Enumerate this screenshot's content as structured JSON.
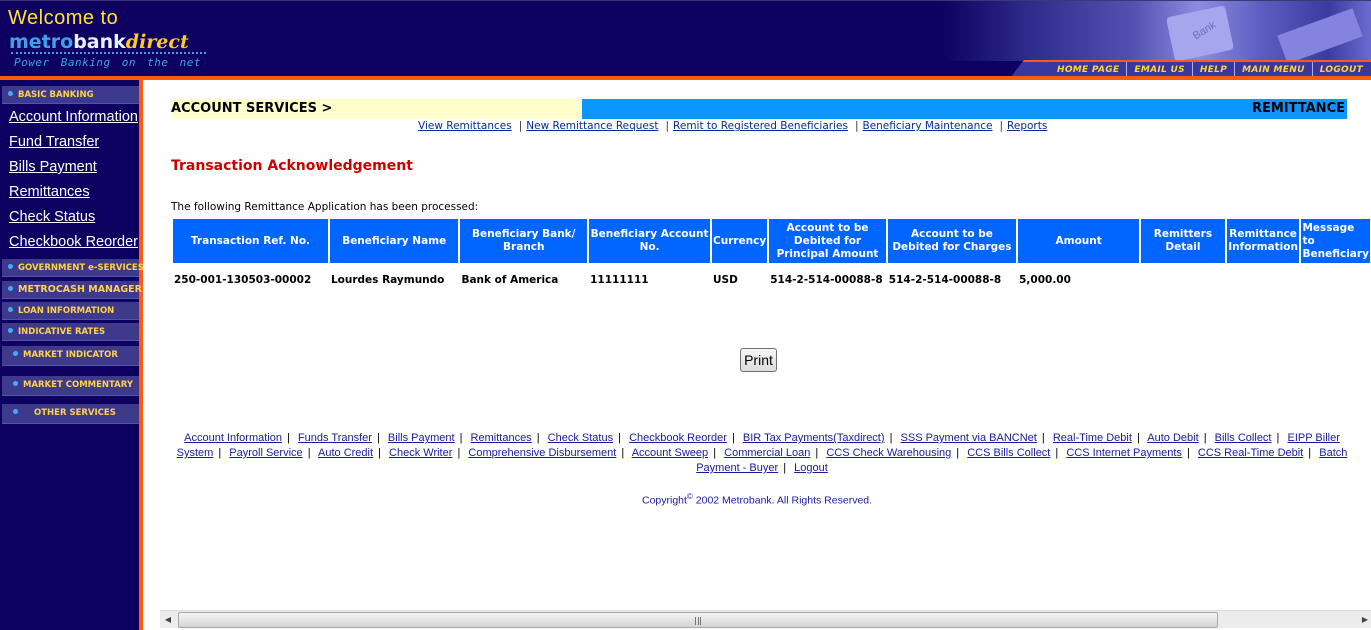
{
  "header": {
    "welcome": "Welcome to",
    "brand_metro": "metro",
    "brand_bank": "bank",
    "brand_direct": "direct",
    "tagline": "Power Banking on the net",
    "photo_key_label": "Bank",
    "nav": [
      {
        "label": "HOME PAGE"
      },
      {
        "label": "EMAIL US"
      },
      {
        "label": "HELP"
      },
      {
        "label": "MAIN MENU"
      },
      {
        "label": "LOGOUT"
      }
    ]
  },
  "sidebar": {
    "basic_banking": "BASIC BANKING",
    "links": [
      {
        "label": "Account Information"
      },
      {
        "label": "Fund Transfer"
      },
      {
        "label": "Bills Payment"
      },
      {
        "label": "Remittances"
      },
      {
        "label": "Check Status"
      },
      {
        "label": "Checkbook Reorder"
      }
    ],
    "sections": [
      {
        "label": "GOVERNMENT e-SERVICES"
      },
      {
        "label": "METROCASH MANAGER"
      },
      {
        "label": "LOAN INFORMATION"
      },
      {
        "label": "INDICATIVE RATES"
      },
      {
        "label": "MARKET INDICATOR"
      },
      {
        "label": "MARKET COMMENTARY"
      },
      {
        "label": "OTHER SERVICES"
      }
    ]
  },
  "breadcrumb": {
    "left": "ACCOUNT SERVICES >",
    "right": "REMITTANCE"
  },
  "subnav": [
    {
      "label": "View Remittances"
    },
    {
      "label": "New Remittance Request"
    },
    {
      "label": "Remit to Registered Beneficiaries"
    },
    {
      "label": "Beneficiary Maintenance"
    },
    {
      "label": "Reports"
    }
  ],
  "main": {
    "title": "Transaction Acknowledgement",
    "intro": "The following Remittance Application has been processed:",
    "table": {
      "headers": [
        "Transaction Ref. No.",
        "Beneficiary Name",
        "Beneficiary Bank/ Branch",
        "Beneficiary Account No.",
        "Currency",
        "Account to be Debited for Principal Amount",
        "Account to be Debited for Charges",
        "Amount",
        "Remitters Detail",
        "Remittance Information",
        "Message to Beneficiary"
      ],
      "rows": [
        [
          "250-001-130503-00002",
          "Lourdes Raymundo",
          "Bank of America",
          "11111111",
          "USD",
          "514-2-514-00088-8",
          "514-2-514-00088-8",
          "5,000.00",
          "",
          "",
          ""
        ]
      ]
    },
    "print_label": "Print"
  },
  "footer": {
    "links": [
      "Account Information",
      "Funds Transfer",
      "Bills Payment",
      "Remittances",
      "Check Status",
      "Checkbook Reorder",
      "BIR Tax Payments(Taxdirect)",
      "SSS Payment via BANCNet",
      "Real-Time Debit",
      "Auto Debit",
      "Bills Collect",
      "EIPP Biller System",
      "Payroll Service",
      "Auto Credit",
      "Check Writer",
      "Comprehensive Disbursement",
      "Account Sweep",
      "Commercial Loan",
      "CCS Check Warehousing",
      "CCS Bills Collect",
      "CCS Internet Payments",
      "CCS Real-Time Debit",
      "Batch Payment - Buyer",
      "Logout"
    ],
    "copyright_pre": "Copyright",
    "copyright_symbol": "©",
    "copyright_post": " 2002 Metrobank. All Rights Reserved."
  },
  "scrollbar": {
    "left_arrow": "◀",
    "right_arrow": "▶"
  }
}
